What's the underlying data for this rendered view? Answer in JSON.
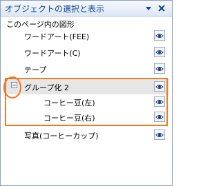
{
  "pane": {
    "title": "オブジェクトの選択と表示",
    "section_label": "このページ内の図形"
  },
  "items": [
    {
      "label": "ワードアート(FEE)",
      "level": 0,
      "visible": true
    },
    {
      "label": "ワードアート(C)",
      "level": 0,
      "visible": true
    },
    {
      "label": "テープ",
      "level": 0,
      "visible": true
    },
    {
      "label": "グループ化 2",
      "level": 0,
      "visible": true,
      "selected": true,
      "expanded": true
    },
    {
      "label": "コーヒー豆(左)",
      "level": 1,
      "visible": true
    },
    {
      "label": "コーヒー豆(右)",
      "level": 1,
      "visible": true
    },
    {
      "label": "写真(コーヒーカップ)",
      "level": 0,
      "visible": true
    }
  ],
  "colors": {
    "highlight": "#f07a22",
    "title_text": "#15428b",
    "selected_row": "#e6e6e6"
  }
}
